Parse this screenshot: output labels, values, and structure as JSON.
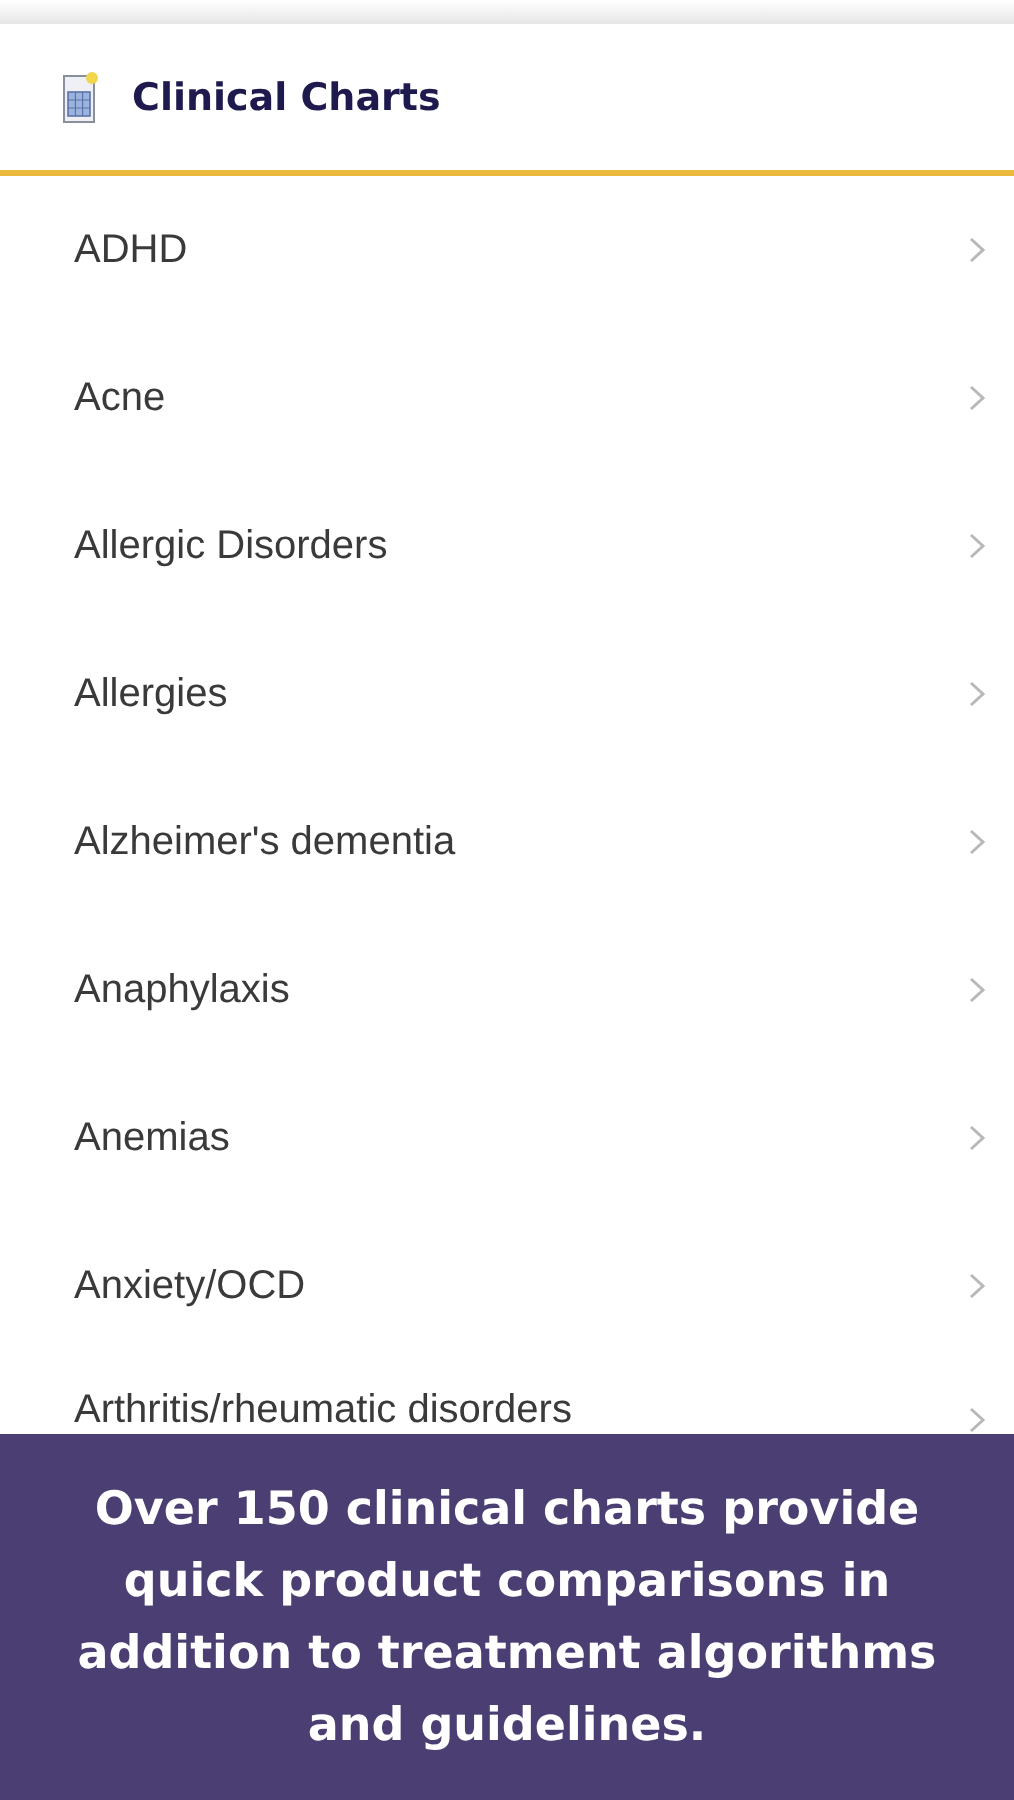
{
  "header": {
    "title": "Clinical Charts"
  },
  "items": [
    {
      "label": "ADHD"
    },
    {
      "label": "Acne"
    },
    {
      "label": "Allergic Disorders"
    },
    {
      "label": "Allergies"
    },
    {
      "label": "Alzheimer's dementia"
    },
    {
      "label": "Anaphylaxis"
    },
    {
      "label": "Anemias"
    },
    {
      "label": "Anxiety/OCD"
    },
    {
      "label": "Arthritis/rheumatic disorders"
    }
  ],
  "banner": {
    "text": "Over 150 clinical charts provide quick product comparisons in addition to treatment algorithms and guidelines."
  }
}
